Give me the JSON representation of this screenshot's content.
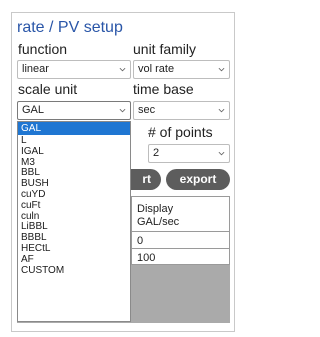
{
  "title": "rate / PV setup",
  "function": {
    "label": "function",
    "value": "linear"
  },
  "unit_family": {
    "label": "unit family",
    "value": "vol rate"
  },
  "scale_unit": {
    "label": "scale unit",
    "value": "GAL",
    "options": [
      "GAL",
      "L",
      "IGAL",
      "M3",
      "BBL",
      "BUSH",
      "cuYD",
      "cuFt",
      "culn",
      "LiBBL",
      "BBBL",
      "HECtL",
      "AF",
      "CUSTOM"
    ],
    "selected_index": 0
  },
  "time_base": {
    "label": "time base",
    "value": "sec"
  },
  "num_points": {
    "label": "# of points",
    "value": "2"
  },
  "buttons": {
    "import_partial": "rt",
    "export": "export"
  },
  "table": {
    "header_display": "Display",
    "header_unit": "GAL/sec",
    "rows": [
      "0",
      "100"
    ]
  },
  "colors": {
    "accent": "#2a56a8",
    "selected": "#1f76d2",
    "button": "#5d5d5d"
  }
}
